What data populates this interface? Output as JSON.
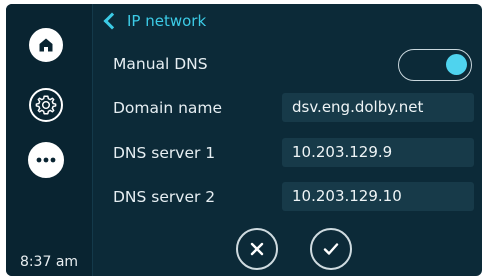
{
  "sidebar": {
    "items": [
      {
        "icon": "home-icon"
      },
      {
        "icon": "gear-icon"
      },
      {
        "icon": "more-icon"
      }
    ],
    "time": "8:37 am"
  },
  "header": {
    "back_icon": "chevron-left-icon",
    "title": "IP network"
  },
  "settings": {
    "manual_dns": {
      "label": "Manual DNS",
      "enabled": true
    },
    "domain_name": {
      "label": "Domain name",
      "value": "dsv.eng.dolby.net"
    },
    "dns_server_1": {
      "label": "DNS server 1",
      "value": "10.203.129.9"
    },
    "dns_server_2": {
      "label": "DNS server 2",
      "value": "10.203.129.10"
    }
  },
  "actions": {
    "cancel_icon": "close-icon",
    "confirm_icon": "check-icon"
  },
  "colors": {
    "background": "#0c2a38",
    "sidebar": "#092431",
    "accent": "#3ccbe6",
    "field": "#173a49"
  }
}
